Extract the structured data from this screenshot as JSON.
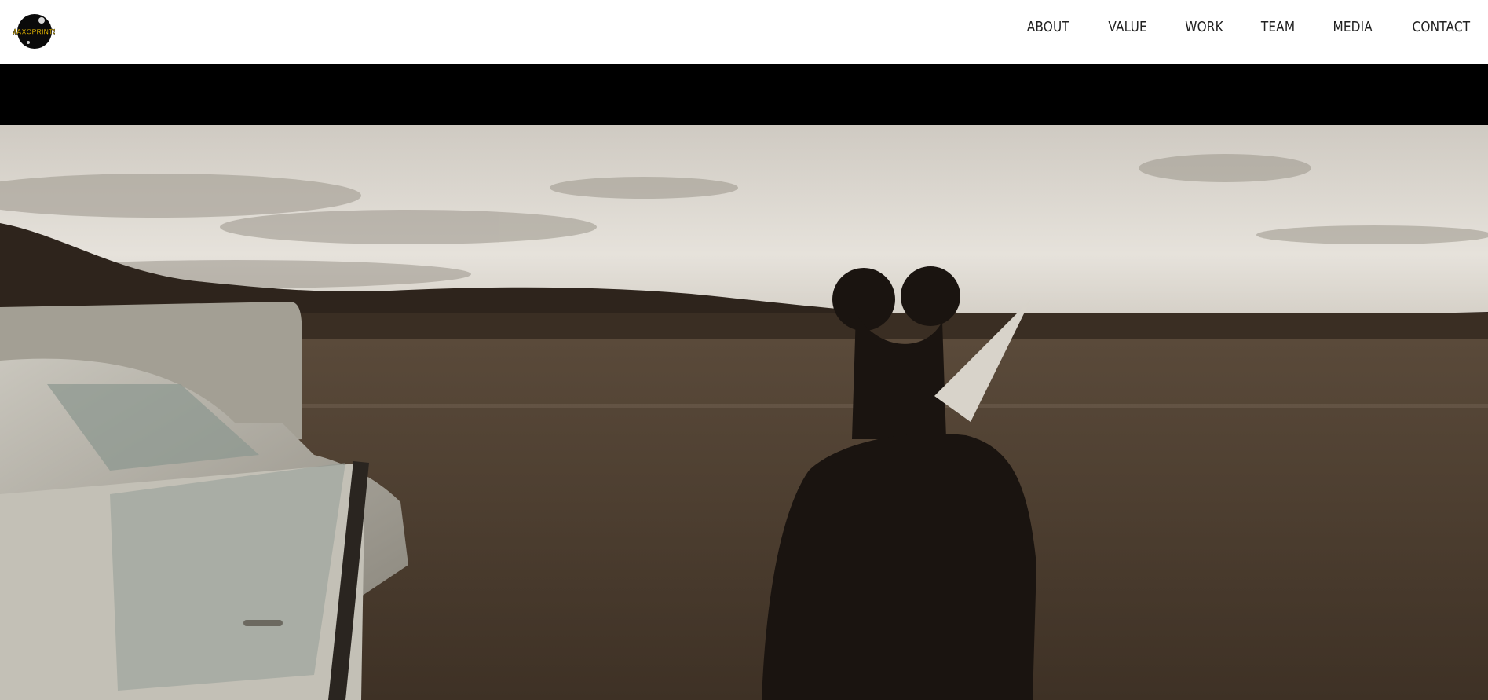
{
  "brand": {
    "logo_text": "MAXOPRINTS",
    "logo_colors": {
      "circle": "#0a0a0a",
      "text": "#f5c400"
    }
  },
  "nav": {
    "items": [
      {
        "label": "ABOUT"
      },
      {
        "label": "VALUE"
      },
      {
        "label": "WORK"
      },
      {
        "label": "TEAM"
      },
      {
        "label": "MEDIA"
      },
      {
        "label": "CONTACT"
      }
    ]
  },
  "hero": {
    "description_icon": "hero-video-frame",
    "palette": {
      "sky": "#d9d4cc",
      "hills": "#2a2018",
      "field": "#4a3c2f",
      "band": "#000000"
    }
  }
}
